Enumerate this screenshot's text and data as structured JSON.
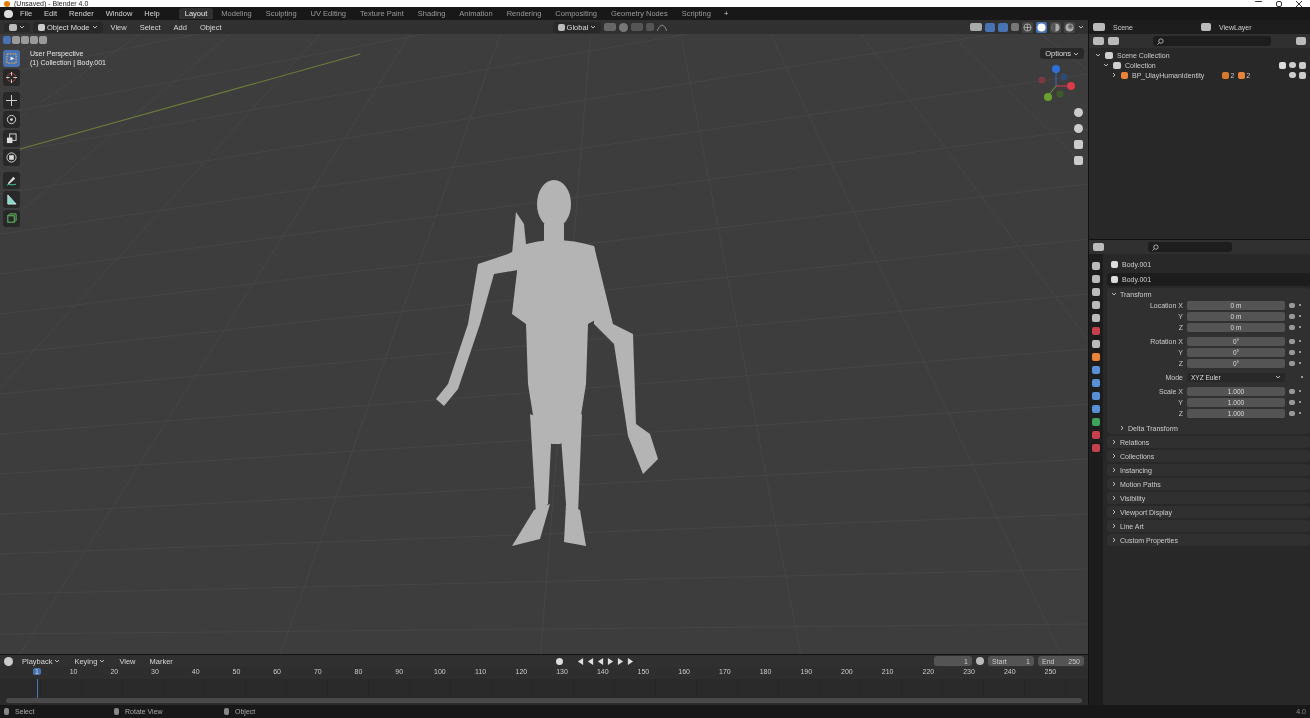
{
  "title_bar": {
    "title": "(Unsaved) - Blender 4.0"
  },
  "menu_bar": {
    "menus": [
      "File",
      "Edit",
      "Render",
      "Window",
      "Help"
    ],
    "workspaces": [
      {
        "label": "Layout",
        "selected": true
      },
      {
        "label": "Modeling",
        "selected": false
      },
      {
        "label": "Sculpting",
        "selected": false
      },
      {
        "label": "UV Editing",
        "selected": false
      },
      {
        "label": "Texture Paint",
        "selected": false
      },
      {
        "label": "Shading",
        "selected": false
      },
      {
        "label": "Animation",
        "selected": false
      },
      {
        "label": "Rendering",
        "selected": false
      },
      {
        "label": "Compositing",
        "selected": false
      },
      {
        "label": "Geometry Nodes",
        "selected": false
      },
      {
        "label": "Scripting",
        "selected": false
      }
    ],
    "add_tab": "+"
  },
  "viewport": {
    "mode": "Object Mode",
    "menus": [
      "View",
      "Select",
      "Add",
      "Object"
    ],
    "orientation": "Global",
    "options": "Options",
    "overlay_text": [
      "User Perspective",
      "(1) Collection | Body.001"
    ],
    "shading": [
      {
        "kind": "wireframe",
        "selected": false
      },
      {
        "kind": "solid",
        "selected": true
      },
      {
        "kind": "material",
        "selected": false
      },
      {
        "kind": "rendered",
        "selected": false
      }
    ],
    "tools": [
      {
        "kind": "select",
        "selected": true
      },
      {
        "kind": "cursor",
        "selected": false
      },
      {
        "kind": "move",
        "selected": false
      },
      {
        "kind": "rotate",
        "selected": false
      },
      {
        "kind": "scale",
        "selected": false
      },
      {
        "kind": "transform",
        "selected": false
      },
      {
        "kind": "annotate",
        "selected": false
      },
      {
        "kind": "measure",
        "selected": false
      },
      {
        "kind": "add-cube",
        "selected": false
      }
    ]
  },
  "outliner": {
    "scene": "Scene",
    "view_layer": "ViewLayer",
    "tree": [
      {
        "label": "Scene Collection",
        "expanded": true,
        "children": [
          {
            "label": "Collection",
            "expanded": true,
            "checked": true,
            "children": [
              {
                "label": "BP_UlayHumanIdentity",
                "expanded": false,
                "badges": [
                  "2",
                  "2"
                ]
              }
            ]
          }
        ]
      }
    ]
  },
  "properties": {
    "object_name": "Body.001",
    "data_name": "Body.001",
    "transform": {
      "title": "Transform",
      "expanded": true,
      "groups": [
        {
          "rows": [
            {
              "label": "Location X",
              "value": "0 m"
            },
            {
              "label": "Y",
              "value": "0 m"
            },
            {
              "label": "Z",
              "value": "0 m"
            }
          ]
        },
        {
          "rows": [
            {
              "label": "Rotation X",
              "value": "0°"
            },
            {
              "label": "Y",
              "value": "0°"
            },
            {
              "label": "Z",
              "value": "0°"
            }
          ]
        },
        {
          "mode_label": "Mode",
          "mode_value": "XYZ Euler",
          "rows": [
            {
              "label": "Scale X",
              "value": "1.000"
            },
            {
              "label": "Y",
              "value": "1.000"
            },
            {
              "label": "Z",
              "value": "1.000"
            }
          ]
        }
      ],
      "subpanel": {
        "title": "Delta Transform",
        "expanded": false
      }
    },
    "panels": [
      {
        "title": "Relations",
        "expanded": false
      },
      {
        "title": "Collections",
        "expanded": false
      },
      {
        "title": "Instancing",
        "expanded": false
      },
      {
        "title": "Motion Paths",
        "expanded": false
      },
      {
        "title": "Visibility",
        "expanded": false
      },
      {
        "title": "Viewport Display",
        "expanded": false
      },
      {
        "title": "Line Art",
        "expanded": false
      },
      {
        "title": "Custom Properties",
        "expanded": false
      }
    ]
  },
  "timeline": {
    "menus": [
      "Playback",
      "Keying",
      "View",
      "Marker"
    ],
    "current_frame": "1",
    "start_label": "Start",
    "start": "1",
    "end_label": "End",
    "end": "250",
    "ruler": [
      "1",
      "10",
      "20",
      "30",
      "40",
      "50",
      "60",
      "70",
      "80",
      "90",
      "100",
      "110",
      "120",
      "130",
      "140",
      "150",
      "160",
      "170",
      "180",
      "190",
      "200",
      "210",
      "220",
      "230",
      "240",
      "250"
    ]
  },
  "status_bar": {
    "items": [
      "Select",
      "Rotate View",
      "Object"
    ],
    "version": "4.0"
  }
}
